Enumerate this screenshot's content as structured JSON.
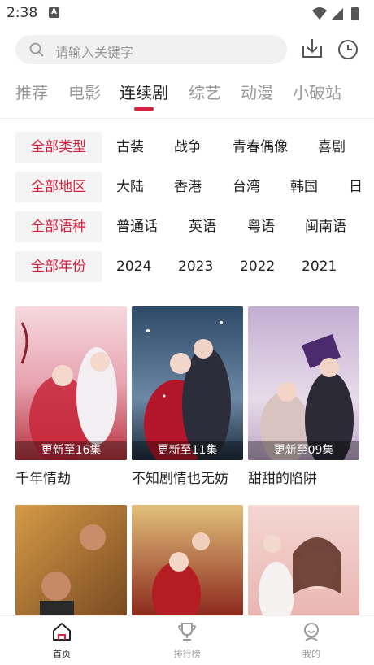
{
  "status": {
    "time": "2:38",
    "notif_letter": "A"
  },
  "search": {
    "placeholder": "请输入关键字"
  },
  "tabs": [
    {
      "label": "推荐",
      "active": false
    },
    {
      "label": "电影",
      "active": false
    },
    {
      "label": "连续剧",
      "active": true
    },
    {
      "label": "综艺",
      "active": false
    },
    {
      "label": "动漫",
      "active": false
    },
    {
      "label": "小破站",
      "active": false
    }
  ],
  "filters": [
    {
      "all": "全部类型",
      "options": [
        "古装",
        "战争",
        "青春偶像",
        "喜剧"
      ]
    },
    {
      "all": "全部地区",
      "options": [
        "大陆",
        "香港",
        "台湾",
        "韩国",
        "日"
      ]
    },
    {
      "all": "全部语种",
      "options": [
        "普通话",
        "英语",
        "粤语",
        "闽南语"
      ]
    },
    {
      "all": "全部年份",
      "options": [
        "2024",
        "2023",
        "2022",
        "2021"
      ]
    }
  ],
  "posters": [
    {
      "title": "千年情劫",
      "update": "更新至16集"
    },
    {
      "title": "不知剧情也无妨",
      "update": "更新至11集"
    },
    {
      "title": "甜甜的陷阱",
      "update": "更新至09集"
    },
    {
      "title": "",
      "update": ""
    },
    {
      "title": "",
      "update": ""
    },
    {
      "title": "",
      "update": ""
    }
  ],
  "bottom_nav": [
    {
      "label": "首页",
      "icon": "home-icon",
      "active": true
    },
    {
      "label": "排行榜",
      "icon": "trophy-icon",
      "active": false
    },
    {
      "label": "我的",
      "icon": "profile-icon",
      "active": false
    }
  ],
  "colors": {
    "accent": "#d5213d"
  }
}
